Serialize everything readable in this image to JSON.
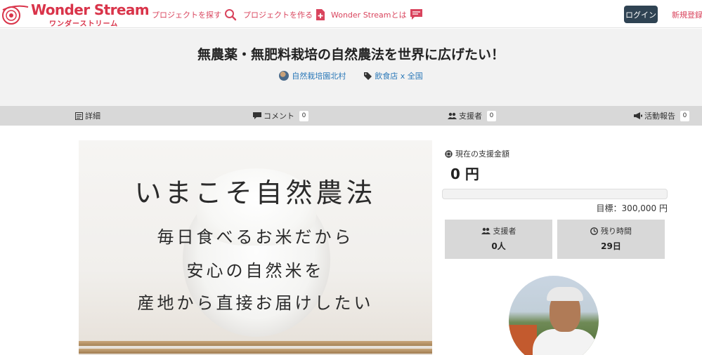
{
  "header": {
    "logo_title": "Wonder Stream",
    "logo_subtitle": "ワンダーストリーム",
    "nav": [
      {
        "label": "プロジェクトを探す",
        "icon": "search-icon"
      },
      {
        "label": "プロジェクトを作る",
        "icon": "document-plus-icon"
      },
      {
        "label": "Wonder Streamとは",
        "icon": "chat-bubble-icon"
      }
    ],
    "login_label": "ログイン",
    "register_label": "新規登録",
    "brand_color": "#d9445d"
  },
  "project": {
    "title": "無農薬・無肥料栽培の自然農法を世界に広げたい！",
    "author": "自然栽培園北村",
    "category": "飲食店 x 全国"
  },
  "tabs": [
    {
      "label": "詳細",
      "icon": "document-icon"
    },
    {
      "label": "コメント",
      "icon": "comment-icon",
      "count": "0"
    },
    {
      "label": "支援者",
      "icon": "users-icon",
      "count": "0"
    },
    {
      "label": "活動報告",
      "icon": "megaphone-icon",
      "count": "0"
    }
  ],
  "main_image": {
    "heading": "いまこそ自然農法",
    "lines": [
      "毎日食べるお米だから",
      "安心の自然米を",
      "産地から直接お届けしたい"
    ]
  },
  "funding": {
    "label": "現在の支援金額",
    "amount": "0 円",
    "progress_percent": 0,
    "goal": "目標：300,000 円",
    "supporters_label": "支援者",
    "supporters_value": "0人",
    "remaining_label": "残り時間",
    "remaining_value": "29日"
  }
}
